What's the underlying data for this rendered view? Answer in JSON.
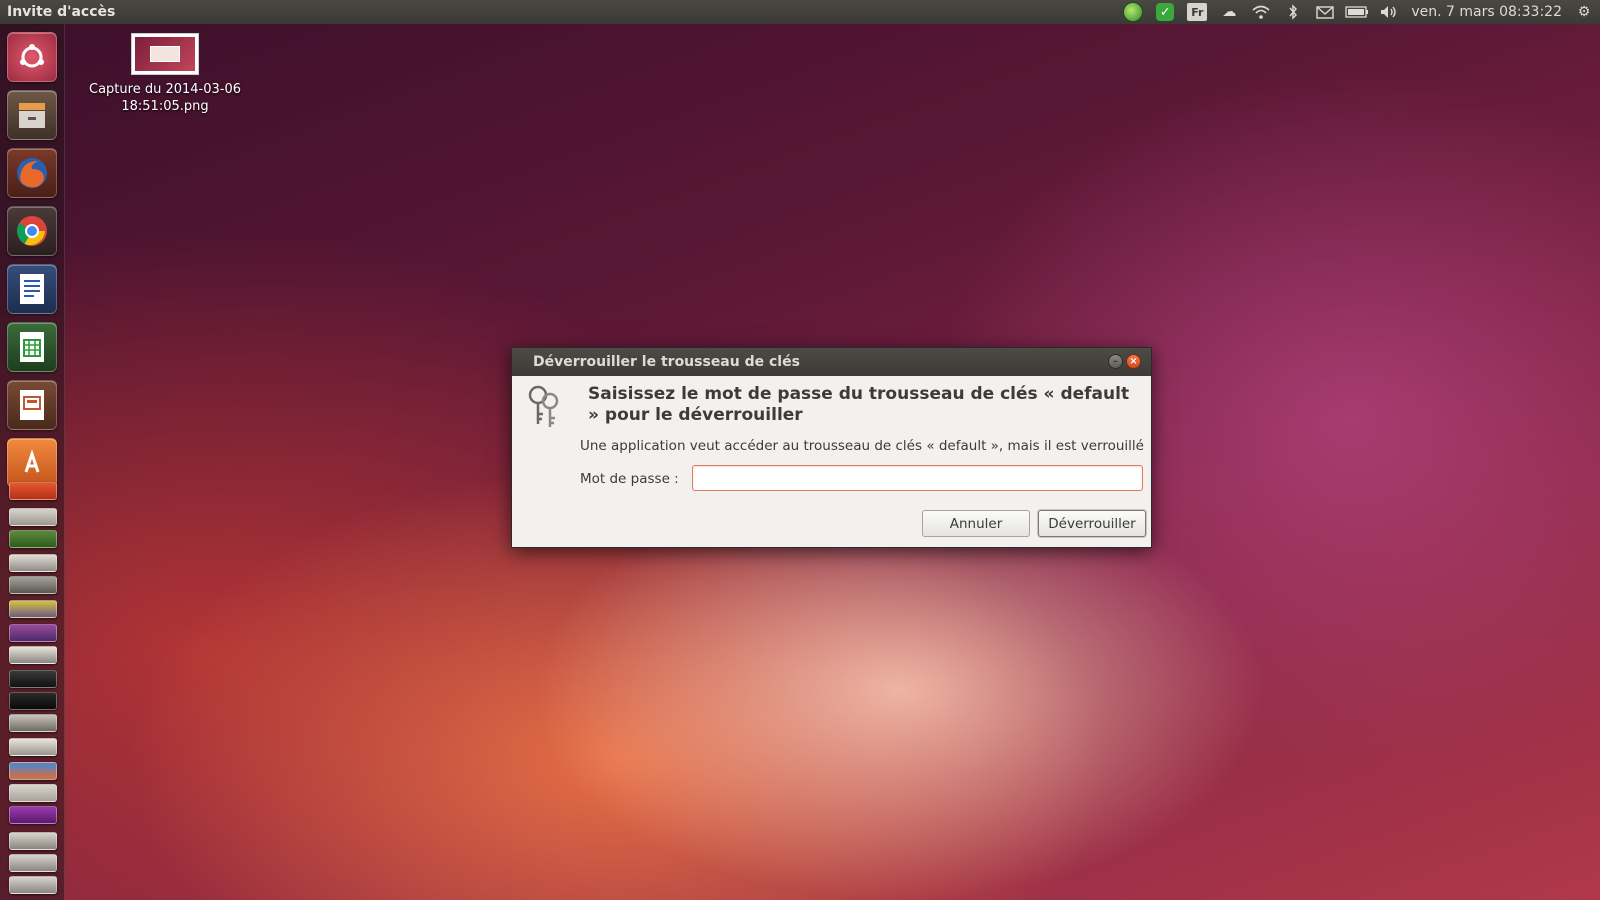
{
  "top_panel": {
    "app_title": "Invite d'accès",
    "indicators": {
      "language": "Fr",
      "clock": "ven. 7 mars  08:33:22"
    }
  },
  "launcher": {
    "items": [
      {
        "name": "dash-home",
        "color": "#c5485f"
      },
      {
        "name": "files",
        "color": "#8a6f55"
      },
      {
        "name": "firefox",
        "color": "#e2662a"
      },
      {
        "name": "chrome",
        "color": "#3d7ed8"
      },
      {
        "name": "libreoffice-writer",
        "color": "#2b5aa8"
      },
      {
        "name": "libreoffice-calc",
        "color": "#2e9a3f"
      },
      {
        "name": "libreoffice-impress",
        "color": "#c4572f"
      },
      {
        "name": "software-center",
        "color": "#e8722f"
      }
    ]
  },
  "desktop": {
    "file_label": "Capture du 2014-03-06 18:51:05.png"
  },
  "dialog": {
    "title": "Déverrouiller le trousseau de clés",
    "heading": "Saisissez le mot de passe du trousseau de clés « default » pour le déverrouiller",
    "description": "Une application veut accéder au trousseau de clés « default », mais il est verrouillé",
    "password_label": "Mot de passe :",
    "password_value": "",
    "cancel_label": "Annuler",
    "unlock_label": "Déverrouiller"
  }
}
